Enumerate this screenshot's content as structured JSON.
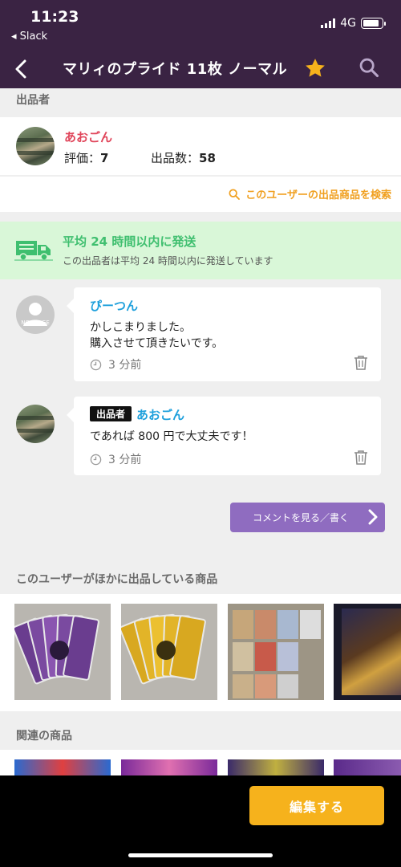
{
  "status": {
    "time": "11:23",
    "back_app": "◂ Slack",
    "network": "4G",
    "battery_level": 0.85
  },
  "nav": {
    "title": "マリィのプライド 11枚 ノーマル",
    "icons": [
      "back-icon",
      "star-icon",
      "search-icon"
    ]
  },
  "seller": {
    "section_label": "出品者",
    "name": "あおごん",
    "rating_label": "評価：",
    "rating_value": "7",
    "count_label": "出品数：",
    "count_value": "58",
    "search_link": "このユーザーの出品商品を検索"
  },
  "shipping": {
    "title": "平均 24 時間以内に発送",
    "subtitle": "この出品者は平均 24 時間以内に発送しています"
  },
  "comments": [
    {
      "name": "ぴーつん",
      "avatar_text": "NO IMAGE",
      "body": "かしこまりました。\n購入させて頂きたいです。",
      "time": "3 分前",
      "seller_tag": ""
    },
    {
      "name": "あおごん",
      "avatar_text": "",
      "body": "であれば 800 円で大丈夫です！",
      "time": "3 分前",
      "seller_tag": "出品者"
    }
  ],
  "comment_button": {
    "label": "コメントを見る／書く"
  },
  "other_products": {
    "section_label": "このユーザーがほかに出品している商品"
  },
  "related_products": {
    "section_label": "関連の商品"
  },
  "bottom": {
    "edit_label": "編集する"
  },
  "colors": {
    "nav_bg": "#3a2343",
    "accent_star": "#f6b21c",
    "seller_name": "#e0455a",
    "commenter_name": "#1ea0dc",
    "ship_green": "#3fbf6f",
    "button_purple": "#8f6cc0"
  }
}
